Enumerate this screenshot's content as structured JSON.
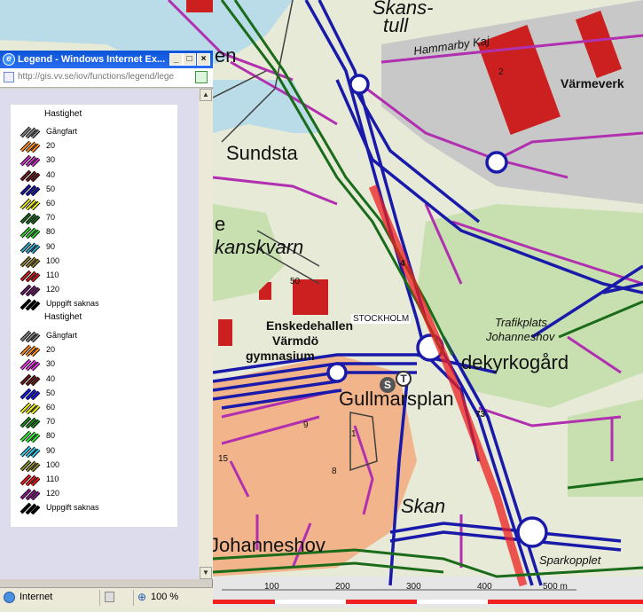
{
  "map": {
    "labels": {
      "skanstull": "Skans-",
      "skanstull2": "tull",
      "hammarby": "Hammarby Kaj",
      "varmeverk": "Värmeverk",
      "sundsta": "Sundsta",
      "kanskvarn": "kanskvarn",
      "num50": "50",
      "num4": "4",
      "stockholm": "STOCKHOLM",
      "enskede1": "Enskedehallen",
      "enskede2": "Värmdö",
      "enskede3": "gymnasium",
      "trafikplats1": "Trafikplats",
      "trafikplats2": "Johanneshov",
      "kyrkogard": "dekyrkogård",
      "gullmars": "Gullmarsplan",
      "num73": "73",
      "skarp": "Skan",
      "johanneshov": "Johanneshov",
      "kopplet": "Sparkopplet",
      "num15": "15",
      "num9": "9",
      "num8": "8",
      "num1": "1",
      "num2": "2",
      "st_s": "S",
      "st_t": "T",
      "e_top": "en",
      "e_mid": "e"
    },
    "scale": {
      "ticks": [
        "100",
        "200",
        "300",
        "400",
        "500 m"
      ]
    }
  },
  "window": {
    "title": "Legend - Windows Internet Ex...",
    "url": "http://gis.vv.se/iov/functions/legend/lege",
    "minimize": "_",
    "maximize": "□",
    "close": "×"
  },
  "legend": {
    "heading1": "Hastighet",
    "heading2": "Hastighet",
    "group1": [
      {
        "label": "Gångfart",
        "color": "#808080"
      },
      {
        "label": "20",
        "color": "#ff8c1a"
      },
      {
        "label": "30",
        "color": "#cc33cc"
      },
      {
        "label": "40",
        "color": "#6b1a1a"
      },
      {
        "label": "50",
        "color": "#1a1aaa"
      },
      {
        "label": "60",
        "color": "#e6e61a"
      },
      {
        "label": "70",
        "color": "#1a6b1a"
      },
      {
        "label": "80",
        "color": "#33cc33"
      },
      {
        "label": "90",
        "color": "#33aacc"
      },
      {
        "label": "100",
        "color": "#8a7a2a"
      },
      {
        "label": "110",
        "color": "#cc1a1a"
      },
      {
        "label": "120",
        "color": "#6b1a6b"
      },
      {
        "label": "Uppgift saknas",
        "color": "#000000"
      }
    ],
    "group2": [
      {
        "label": "Gångfart",
        "color": "#808080"
      },
      {
        "label": "20",
        "color": "#ff8c1a"
      },
      {
        "label": "30",
        "color": "#e633e6"
      },
      {
        "label": "40",
        "color": "#6b1a1a"
      },
      {
        "label": "50",
        "color": "#1a1aee"
      },
      {
        "label": "60",
        "color": "#f0f01a"
      },
      {
        "label": "70",
        "color": "#1a8a1a"
      },
      {
        "label": "80",
        "color": "#33ee33"
      },
      {
        "label": "90",
        "color": "#33ccee"
      },
      {
        "label": "100",
        "color": "#8a8a2a"
      },
      {
        "label": "110",
        "color": "#ee1a1a"
      },
      {
        "label": "120",
        "color": "#8a1a8a"
      },
      {
        "label": "Uppgift saknas",
        "color": "#000000"
      }
    ]
  },
  "statusbar": {
    "zone": "Internet",
    "zoom": "100 %"
  }
}
